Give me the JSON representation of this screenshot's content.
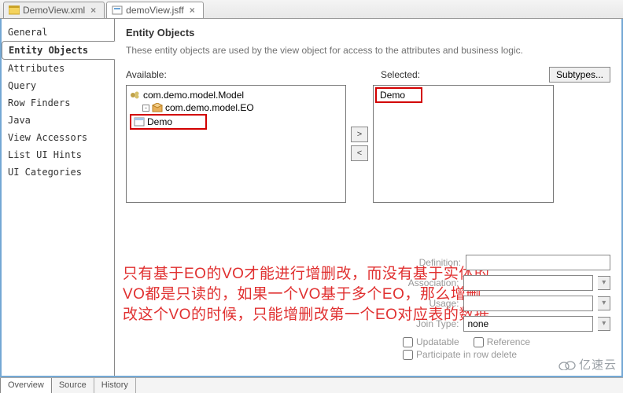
{
  "tabs_top": [
    {
      "label": "DemoView.xml",
      "active": false
    },
    {
      "label": "demoView.jsff",
      "active": true
    }
  ],
  "sidebar": {
    "items": [
      "General",
      "Entity Objects",
      "Attributes",
      "Query",
      "Row Finders",
      "Java",
      "View Accessors",
      "List UI Hints",
      "UI Categories"
    ],
    "active_index": 1
  },
  "main": {
    "title": "Entity Objects",
    "description": "These entity objects are used by the view object for access to the attributes and business logic.",
    "available_label": "Available:",
    "selected_label": "Selected:",
    "subtypes_btn": "Subtypes...",
    "tree": {
      "root": "com.demo.model.Model",
      "pkg": "com.demo.model.EO",
      "leaf": "Demo"
    },
    "selected_item": "Demo",
    "shuttle": {
      "right": ">",
      "left": "<"
    }
  },
  "props": {
    "definition_label": "Definition:",
    "association_label": "Association:",
    "usage_label": "Usage:",
    "join_type_label": "Join Type:",
    "join_type_value": "none",
    "updatable": "Updatable",
    "reference": "Reference",
    "participate": "Participate in row delete"
  },
  "annotation_text": "只有基于EO的VO才能进行增删改，而没有基于实体的VO都是只读的，如果一个VO基于多个EO，那么增删改这个VO的时候，只能增删改第一个EO对应表的数据",
  "tabs_bottom": [
    "Overview",
    "Source",
    "History"
  ],
  "tabs_bottom_active": 0,
  "watermark": "亿速云"
}
